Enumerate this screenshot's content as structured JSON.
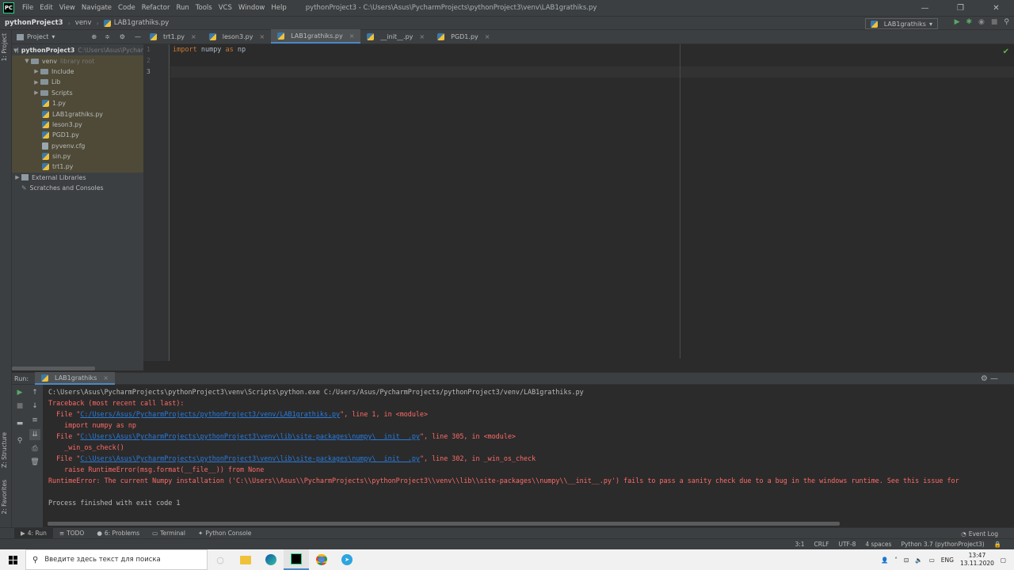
{
  "menubar": {
    "items": [
      "File",
      "Edit",
      "View",
      "Navigate",
      "Code",
      "Refactor",
      "Run",
      "Tools",
      "VCS",
      "Window",
      "Help"
    ],
    "window_title": "pythonProject3 - C:\\Users\\Asus\\PycharmProjects\\pythonProject3\\venv\\LAB1grathiks.py"
  },
  "navbar": {
    "project": "pythonProject3",
    "folder": "venv",
    "file": "LAB1grathiks.py",
    "run_config": "LAB1grathiks"
  },
  "left_stripe": {
    "project_tab": "1: Project",
    "structure_tab": "Z: Structure",
    "favorites_tab": "2: Favorites"
  },
  "project_panel": {
    "title": "Project",
    "root": {
      "name": "pythonProject3",
      "path": "C:\\Users\\Asus\\Pychar"
    },
    "venv": {
      "name": "venv",
      "note": "library root"
    },
    "folders": [
      "Include",
      "Lib",
      "Scripts"
    ],
    "files": [
      "1.py",
      "LAB1grathiks.py",
      "leson3.py",
      "PGD1.py",
      "pyvenv.cfg",
      "sin.py",
      "trt1.py"
    ],
    "external": "External Libraries",
    "scratches": "Scratches and Consoles"
  },
  "editor_tabs": [
    "trt1.py",
    "leson3.py",
    "LAB1grathiks.py",
    "__init__.py",
    "PGD1.py"
  ],
  "editor": {
    "line_numbers": [
      "1",
      "2",
      "3"
    ],
    "line1": {
      "kw1": "import",
      "mod": " numpy ",
      "kw2": "as",
      "alias": " np"
    }
  },
  "run_panel": {
    "label": "Run:",
    "tab": "LAB1grathiks",
    "console": {
      "cmd": "C:\\Users\\Asus\\PycharmProjects\\pythonProject3\\venv\\Scripts\\python.exe C:/Users/Asus/PycharmProjects/pythonProject3/venv/LAB1grathiks.py",
      "traceback": "Traceback (most recent call last):",
      "f1_pre": "  File \"",
      "f1_link": "C:/Users/Asus/PycharmProjects/pythonProject3/venv/LAB1grathiks.py",
      "f1_post": "\", line 1, in <module>",
      "f1_code": "    import numpy as np",
      "f2_pre": "  File \"",
      "f2_link": "C:\\Users\\Asus\\PycharmProjects\\pythonProject3\\venv\\lib\\site-packages\\numpy\\__init__.py",
      "f2_post": "\", line 305, in <module>",
      "f2_code": "    _win_os_check()",
      "f3_pre": "  File \"",
      "f3_link": "C:\\Users\\Asus\\PycharmProjects\\pythonProject3\\venv\\lib\\site-packages\\numpy\\__init__.py",
      "f3_post": "\", line 302, in _win_os_check",
      "f3_code": "    raise RuntimeError(msg.format(__file__)) from None",
      "error": "RuntimeError: The current Numpy installation ('C:\\\\Users\\\\Asus\\\\PycharmProjects\\\\pythonProject3\\\\venv\\\\lib\\\\site-packages\\\\numpy\\\\__init__.py') fails to pass a sanity check due to a bug in the windows runtime. See this issue for",
      "blank": " ",
      "finished": "Process finished with exit code 1"
    }
  },
  "bottom_tabs": [
    "4: Run",
    "TODO",
    "6: Problems",
    "Terminal",
    "Python Console"
  ],
  "event_log": "Event Log",
  "status": {
    "position": "3:1",
    "line_sep": "CRLF",
    "encoding": "UTF-8",
    "indent": "4 spaces",
    "interpreter": "Python 3.7 (pythonProject3)"
  },
  "taskbar": {
    "search_placeholder": "Введите здесь текст для поиска",
    "lang": "ENG",
    "time": "13:47",
    "date": "13.11.2020"
  }
}
